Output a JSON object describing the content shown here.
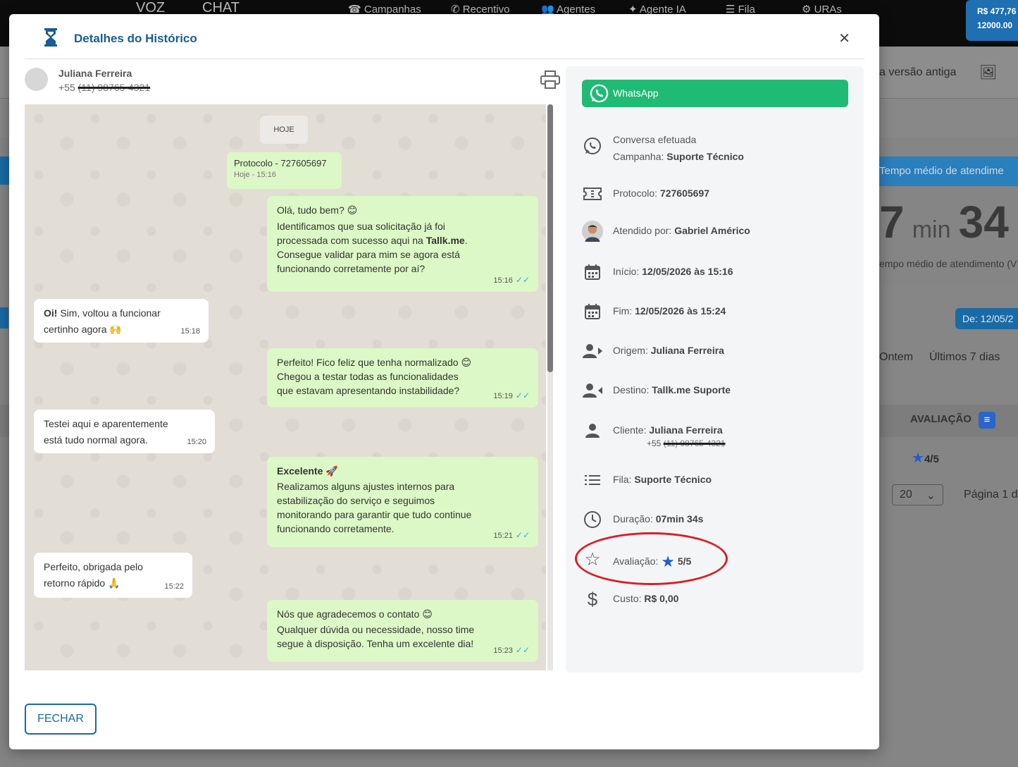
{
  "bg": {
    "nav": [
      "VOZ",
      "CHAT",
      "Campanhas",
      "Recentivo",
      "Agentes",
      "Agente IA",
      "Fila",
      "URAs"
    ],
    "balance": [
      "R$ 477,76",
      "12000.00"
    ],
    "version_link": "a versão antiga",
    "metric_label": "Tempo médio de atendime",
    "metric_big": "7 min 34",
    "metric_sub": "empo médio de atendimento (V",
    "date_filter": "De: 12/05/2",
    "filter_ontem": "Ontem",
    "filter_7dias": "Últimos 7 dias",
    "col_avaliacao": "AVALIAÇÃO",
    "row_rating": "4/5",
    "page_size": "20",
    "page_label": "Página 1 d"
  },
  "modal": {
    "title": "Detalhes do Histórico",
    "contact_name": "Juliana Ferreira",
    "contact_prefix": "+55",
    "contact_hidden": "(11) 98765-4321",
    "close_label": "FECHAR"
  },
  "chat": {
    "day": "HOJE",
    "protocol_title": "Protocolo - 727605697",
    "protocol_sub": "Hoje - 15:16",
    "m1": {
      "l1": "Olá, tudo bem? 😊",
      "l2": "Identificamos que sua solicitação já foi",
      "l3a": "processada com sucesso aqui na ",
      "l3b": "Tallk.me",
      "l3c": ".",
      "l4": "Consegue validar para mim se agora está",
      "l5": "funcionando corretamente por aí?",
      "time": "15:16"
    },
    "m2": {
      "bold": "Oi!",
      "rest": " Sim, voltou a funcionar",
      "l2": "certinho agora 🙌",
      "time": "15:18"
    },
    "m3": {
      "l1": "Perfeito! Fico feliz que tenha normalizado 😊",
      "l2": "Chegou a testar todas as funcionalidades",
      "l3": "que estavam apresentando instabilidade?",
      "time": "15:19"
    },
    "m4": {
      "l1": "Testei aqui e aparentemente",
      "l2": "está tudo normal agora.",
      "time": "15:20"
    },
    "m5": {
      "title": "Excelente 🚀",
      "l1": "Realizamos alguns ajustes internos para",
      "l2": "estabilização do serviço e seguimos",
      "l3": "monitorando para garantir que tudo continue",
      "l4": "funcionando corretamente.",
      "time": "15:21"
    },
    "m6": {
      "l1": "Perfeito, obrigada pelo",
      "l2": "retorno rápido 🙏",
      "time": "15:22"
    },
    "m7": {
      "l1": "Nós que agradecemos o contato 😊",
      "l2": "Qualquer dúvida ou necessidade, nosso time",
      "l3": "segue à disposição. Tenha um excelente dia!",
      "time": "15:23"
    },
    "ticks": "✓✓"
  },
  "info": {
    "channel": "WhatsApp",
    "status": "Conversa efetuada",
    "campaign_label": "Campanha:",
    "campaign": "Suporte Técnico",
    "protocol_label": "Protocolo:",
    "protocol": "727605697",
    "agent_label": "Atendido por:",
    "agent": "Gabriel Américo",
    "start_label": "Início:",
    "start": "12/05/2026 às 15:16",
    "end_label": "Fim:",
    "end": "12/05/2026 às 15:24",
    "origin_label": "Origem:",
    "origin": "Juliana Ferreira",
    "dest_label": "Destino:",
    "dest": "Tallk.me Suporte",
    "client_label": "Cliente:",
    "client": "Juliana Ferreira",
    "client_prefix": "+55",
    "client_hidden": "(11) 98765-4321",
    "queue_label": "Fila:",
    "queue": "Suporte Técnico",
    "duration_label": "Duração:",
    "duration": "07min 34s",
    "rating_label": "Avaliação:",
    "rating": "5/5",
    "cost_label": "Custo:",
    "cost": "R$ 0,00"
  },
  "colors": {
    "accent": "#1a6aa6",
    "whatsapp": "#1fbb74",
    "bubble_out": "#dcf8c6",
    "annotation": "#d81f26"
  }
}
